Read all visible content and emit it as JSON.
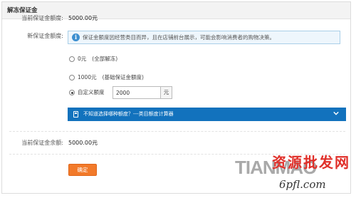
{
  "panel": {
    "title": "解冻保证金"
  },
  "current_deposit": {
    "label": "当前保证金额度:",
    "value": "5000.00元"
  },
  "new_deposit": {
    "label": "新保证金额度:",
    "info_text": "保证金额度因经营类目而异，且在店铺前台展示，可能会影响消费者的购物决策。",
    "options": [
      {
        "label": "0元",
        "note": "(全部解冻)",
        "checked": false
      },
      {
        "label": "1000元",
        "note": "(基础保证金额度)",
        "checked": false
      },
      {
        "label": "自定义额度",
        "note": "",
        "checked": true
      }
    ],
    "custom_amount": "2000",
    "unit": "元"
  },
  "calculator": {
    "text": "不知道选择哪种额度？---类目额度计算器"
  },
  "balance": {
    "label": "当前保证金余额:",
    "value": "5000.00元"
  },
  "confirm_button": "确定",
  "watermark": {
    "brand": "TIANMAO",
    "cn_text": "资源批发网",
    "site": "6pfl.com"
  }
}
